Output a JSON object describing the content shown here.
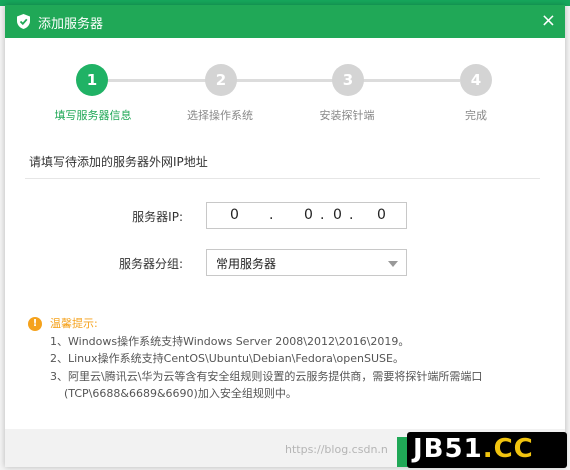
{
  "dialog": {
    "title": "添加服务器",
    "close": "×"
  },
  "steps": [
    {
      "number": "1",
      "label": "填写服务器信息",
      "state": "active"
    },
    {
      "number": "2",
      "label": "选择操作系统",
      "state": "inactive"
    },
    {
      "number": "3",
      "label": "安装探针端",
      "state": "inactive"
    },
    {
      "number": "4",
      "label": "完成",
      "state": "inactive"
    }
  ],
  "form": {
    "section_title": "请填写待添加的服务器外网IP地址",
    "ip_label": "服务器IP:",
    "ip_segments": [
      "0",
      "0",
      "0",
      "0"
    ],
    "ip_dot": ".",
    "group_label": "服务器分组:",
    "group_value": "常用服务器"
  },
  "tips": {
    "heading": "温馨提示:",
    "items": [
      "1、Windows操作系统支持Windows Server 2008\\2012\\2016\\2019。",
      "2、Linux操作系统支持CentOS\\Ubuntu\\Debian\\Fedora\\openSUSE。",
      "3、阿里云\\腾讯云\\华为云等含有安全组规则设置的云服务提供商，需要将探针端所需端口",
      "(TCP\\6688&6689&6690)加入安全组规则中。"
    ]
  },
  "watermark": "https://blog.csdn.n",
  "logo": {
    "part1": "JB51",
    "part2": ".CC"
  },
  "colors": {
    "accent": "#20a857",
    "warning": "#f5a21c",
    "inactive_step": "#d4d4d4"
  }
}
